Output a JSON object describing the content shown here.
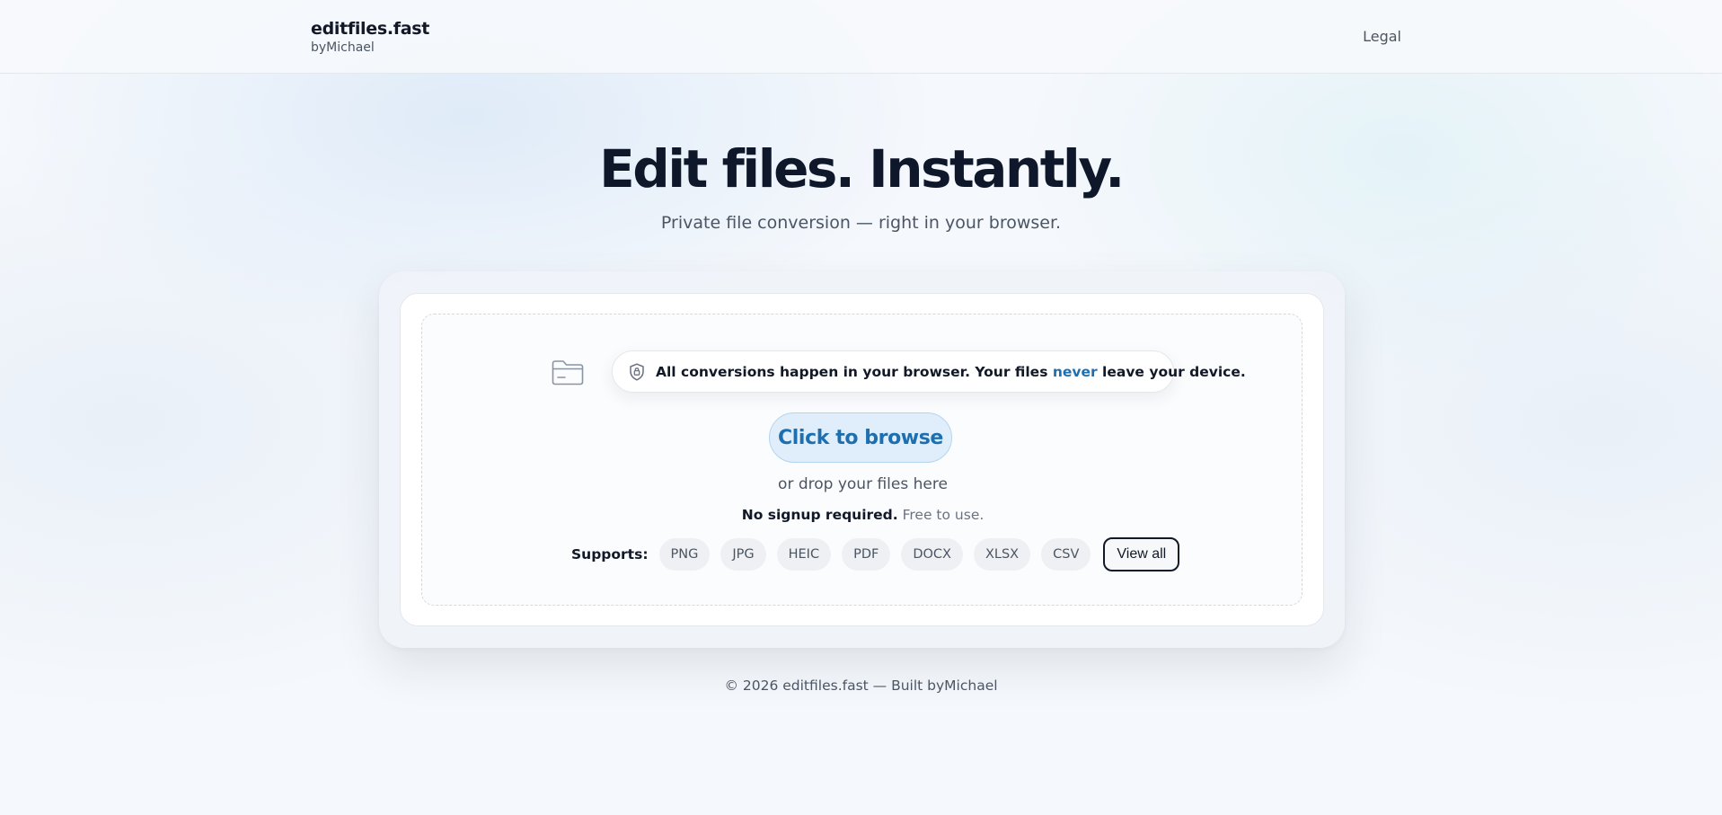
{
  "header": {
    "brand_name": "editfiles.fast",
    "brand_sub": "byMichael",
    "legal_link": "Legal"
  },
  "hero": {
    "title": "Edit files. Instantly.",
    "subtitle": "Private file conversion — right in your browser."
  },
  "upload": {
    "privacy_part1": "All conversions happen in your browser. Your files ",
    "privacy_emphasis": "never",
    "privacy_part2": " leave your device.",
    "browse_label": "Click to browse",
    "drop_text": "or drop your files here",
    "signup_bold": "No signup required.",
    "signup_light": "Free to use.",
    "supports_label": "Supports:",
    "formats": [
      "PNG",
      "JPG",
      "HEIC",
      "PDF",
      "DOCX",
      "XLSX",
      "CSV"
    ],
    "view_all_label": "View all"
  },
  "footer": {
    "text": "© 2026 editfiles.fast — Built byMichael"
  },
  "icons": {
    "folder": "folder-icon",
    "shield": "shield-icon"
  },
  "colors": {
    "accent": "#1d6fb0",
    "accent_bg": "#dfeefa",
    "text_primary": "#0f172a",
    "text_secondary": "#4b5563"
  }
}
